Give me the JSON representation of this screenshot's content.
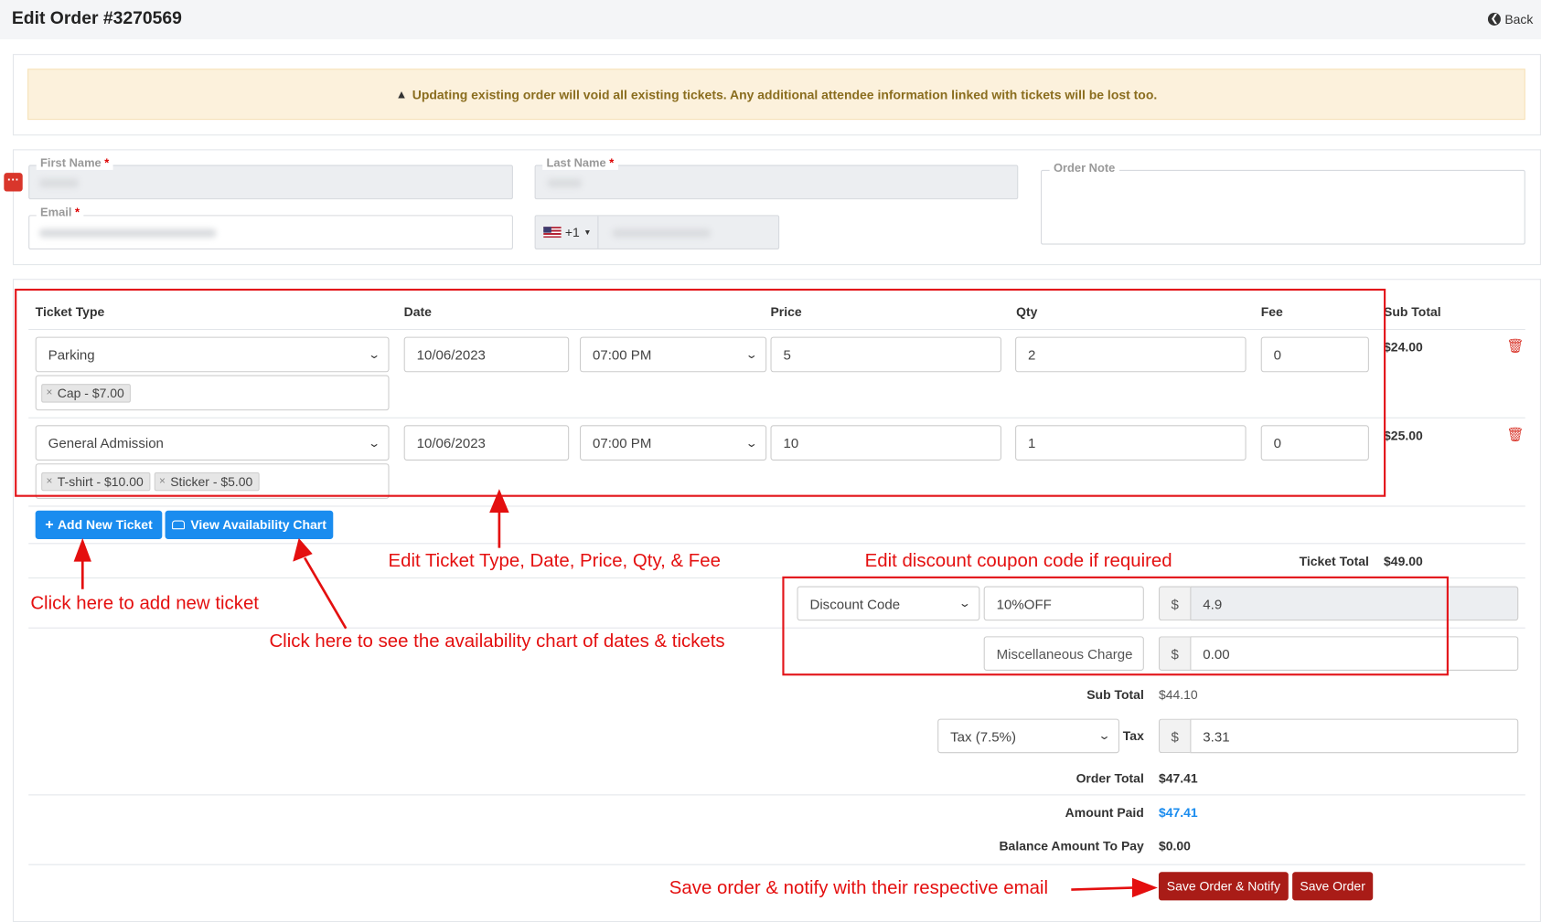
{
  "header": {
    "title": "Edit Order #3270569",
    "back_label": "Back"
  },
  "alert": {
    "text": "Updating existing order will void all existing tickets. Any additional attendee information linked with tickets will be lost too.",
    "icon": "warning-icon"
  },
  "customer": {
    "first_name_label": "First Name",
    "last_name_label": "Last Name",
    "email_label": "Email",
    "required_mark": "*",
    "phone_code": "+1",
    "phone_flag": "us-flag-icon",
    "order_note_label": "Order Note"
  },
  "tickets": {
    "columns": [
      "Ticket Type",
      "Date",
      "Price",
      "Qty",
      "Fee",
      "Sub Total"
    ],
    "rows": [
      {
        "type": "Parking",
        "date": "10/06/2023",
        "time": "07:00 PM",
        "price": "5",
        "qty": "2",
        "fee": "0",
        "subtotal": "$24.00",
        "addons": [
          "Cap - $7.00"
        ]
      },
      {
        "type": "General Admission",
        "date": "10/06/2023",
        "time": "07:00 PM",
        "price": "10",
        "qty": "1",
        "fee": "0",
        "subtotal": "$25.00",
        "addons": [
          "T-shirt - $10.00",
          "Sticker - $5.00"
        ]
      }
    ],
    "addon_remove": "×"
  },
  "buttons": {
    "add_ticket": "Add New Ticket",
    "add_icon": "+",
    "availability": "View Availability Chart",
    "save_notify": "Save Order & Notify",
    "save": "Save Order"
  },
  "totals": {
    "ticket_total_label": "Ticket Total",
    "ticket_total": "$49.00",
    "discount_type": "Discount Code",
    "discount_code": "10%OFF",
    "currency": "$",
    "discount_amount": "4.9",
    "misc_placeholder": "Miscellaneous Charge",
    "misc_amount": "0.00",
    "sub_total_label": "Sub Total",
    "sub_total": "$44.10",
    "tax_select": "Tax (7.5%)",
    "tax_label": "Tax",
    "tax_amount": "3.31",
    "order_total_label": "Order Total",
    "order_total": "$47.41",
    "amount_paid_label": "Amount Paid",
    "amount_paid": "$47.41",
    "balance_label": "Balance Amount To Pay",
    "balance": "$0.00"
  },
  "annotations": {
    "edit_tickets": "Edit Ticket Type, Date, Price, Qty, & Fee",
    "edit_discount": "Edit discount coupon code if required",
    "add_ticket": "Click here to add new ticket",
    "availability": "Click here to see the availability chart of dates & tickets",
    "save": "Save order & notify with their respective email"
  },
  "colors": {
    "annotation": "#e40f0f",
    "primary": "#1a8cef",
    "danger": "#a91c17",
    "link": "#1a8cef"
  }
}
